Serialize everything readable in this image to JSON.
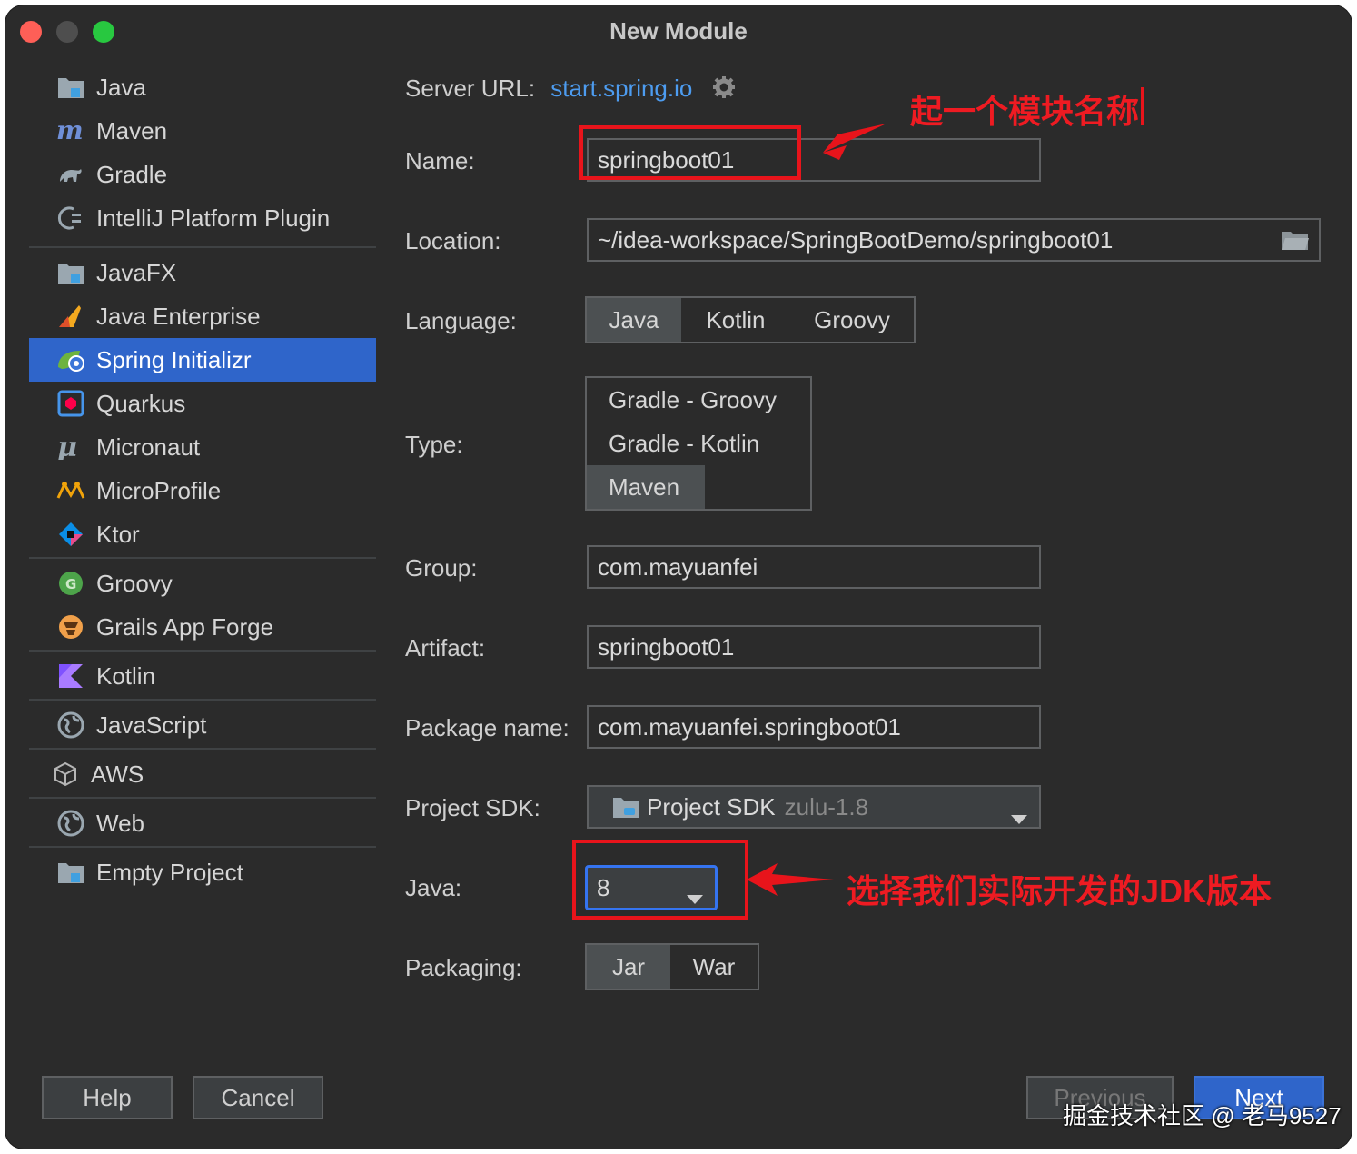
{
  "window": {
    "title": "New Module"
  },
  "sidebar": {
    "items": [
      {
        "label": "Java",
        "icon": "folder-icon"
      },
      {
        "label": "Maven",
        "icon": "maven-icon"
      },
      {
        "label": "Gradle",
        "icon": "gradle-icon"
      },
      {
        "label": "IntelliJ Platform Plugin",
        "icon": "plugin-icon"
      },
      {
        "label": "JavaFX",
        "icon": "folder-icon"
      },
      {
        "label": "Java Enterprise",
        "icon": "java-enterprise-icon"
      },
      {
        "label": "Spring Initializr",
        "icon": "spring-icon",
        "selected": true
      },
      {
        "label": "Quarkus",
        "icon": "quarkus-icon"
      },
      {
        "label": "Micronaut",
        "icon": "micronaut-icon"
      },
      {
        "label": "MicroProfile",
        "icon": "microprofile-icon"
      },
      {
        "label": "Ktor",
        "icon": "ktor-icon"
      },
      {
        "label": "Groovy",
        "icon": "groovy-icon"
      },
      {
        "label": "Grails App Forge",
        "icon": "grails-icon"
      },
      {
        "label": "Kotlin",
        "icon": "kotlin-icon"
      },
      {
        "label": "JavaScript",
        "icon": "globe-icon"
      },
      {
        "label": "AWS",
        "icon": "cube-icon"
      },
      {
        "label": "Web",
        "icon": "globe-icon"
      },
      {
        "label": "Empty Project",
        "icon": "folder-icon"
      }
    ]
  },
  "form": {
    "server_url_label": "Server URL:",
    "server_url": "start.spring.io",
    "name_label": "Name:",
    "name_value": "springboot01",
    "location_label": "Location:",
    "location_value": "~/idea-workspace/SpringBootDemo/springboot01",
    "language_label": "Language:",
    "language_options": [
      "Java",
      "Kotlin",
      "Groovy"
    ],
    "language_selected": "Java",
    "type_label": "Type:",
    "type_options": [
      "Gradle - Groovy",
      "Gradle - Kotlin",
      "Maven"
    ],
    "type_selected": "Maven",
    "group_label": "Group:",
    "group_value": "com.mayuanfei",
    "artifact_label": "Artifact:",
    "artifact_value": "springboot01",
    "package_label": "Package name:",
    "package_value": "com.mayuanfei.springboot01",
    "sdk_label": "Project SDK:",
    "sdk_value": "Project SDK",
    "sdk_version": "zulu-1.8",
    "java_label": "Java:",
    "java_value": "8",
    "packaging_label": "Packaging:",
    "packaging_options": [
      "Jar",
      "War"
    ],
    "packaging_selected": "Jar"
  },
  "buttons": {
    "help": "Help",
    "cancel": "Cancel",
    "previous": "Previous",
    "next": "Next"
  },
  "annotations": {
    "name_note": "起一个模块名称",
    "jdk_note": "选择我们实际开发的JDK版本",
    "color": "#e8141b"
  },
  "watermark": "掘金技术社区 @ 老马9527"
}
